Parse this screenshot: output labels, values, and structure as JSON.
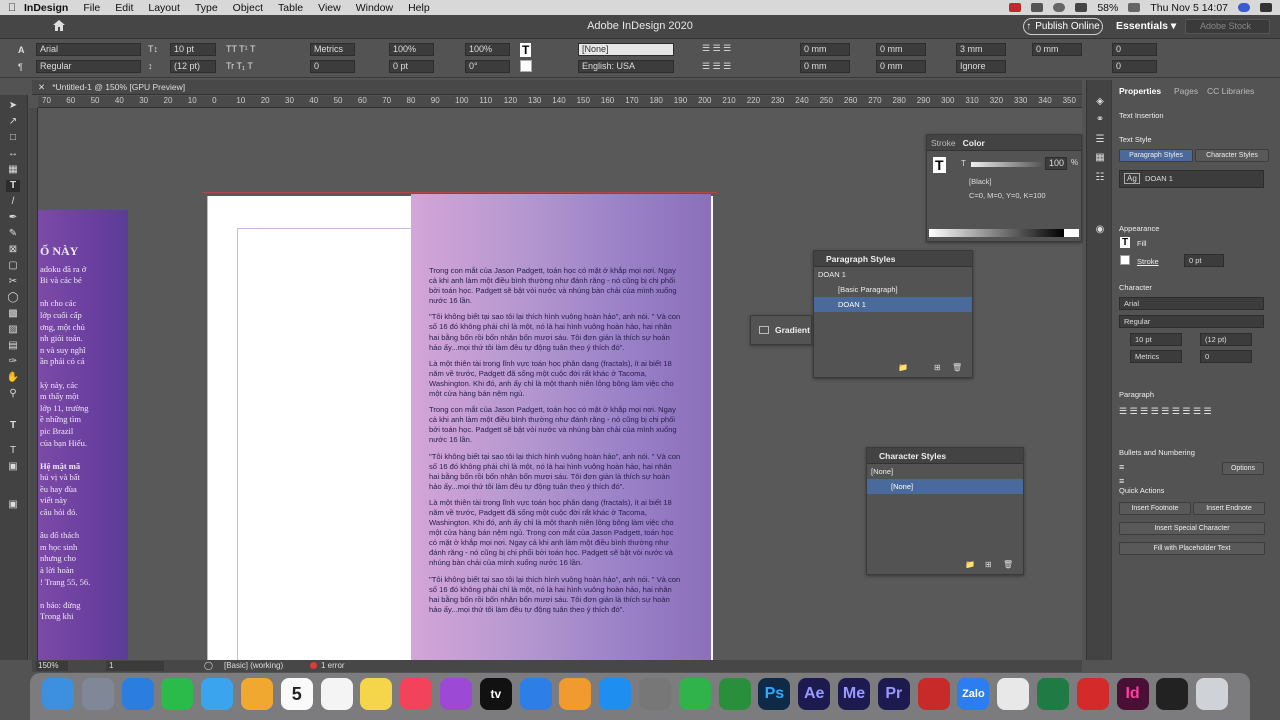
{
  "menubar": {
    "app": "InDesign",
    "items": [
      "File",
      "Edit",
      "Layout",
      "Type",
      "Object",
      "Table",
      "View",
      "Window",
      "Help"
    ],
    "battery": "58%",
    "datetime": "Thu Nov 5  14:07"
  },
  "appbar": {
    "title": "Adobe InDesign 2020",
    "publish": "Publish Online",
    "workspace": "Essentials",
    "search_placeholder": "Adobe Stock"
  },
  "control": {
    "font": "Arial",
    "style": "Regular",
    "size": "10 pt",
    "leading": "(12 pt)",
    "kerning": "Metrics",
    "tracking": "0",
    "vscale": "100%",
    "hscale": "100%",
    "baseline": "0 pt",
    "skew": "0°",
    "char_style": "[None]",
    "language": "English: USA",
    "left_indent": "0 mm",
    "first_indent": "0 mm",
    "space_before": "0 mm",
    "right_indent": "0 mm",
    "last_indent": "0 mm",
    "space_after": "0 mm",
    "col": "0",
    "col2": "0",
    "dropcap": "3 mm",
    "ignore": "Ignore"
  },
  "document": {
    "tab": "*Untitled-1 @ 150% [GPU Preview]",
    "ruler_marks": [
      "70",
      "60",
      "50",
      "40",
      "30",
      "20",
      "10",
      "0",
      "10",
      "20",
      "30",
      "40",
      "50",
      "60",
      "70",
      "80",
      "90",
      "100",
      "110",
      "120",
      "130",
      "140",
      "150",
      "160",
      "170",
      "180",
      "190",
      "200",
      "210",
      "220",
      "230",
      "240",
      "250",
      "260",
      "270",
      "280",
      "290",
      "300",
      "310",
      "320",
      "330",
      "340",
      "350"
    ]
  },
  "left_page_text": [
    "Ố NÀY",
    "adoku đã ra ở",
    "Bi và các bé",
    "",
    "nh cho các",
    "lớp cuối cấp",
    "ơng, một chủ",
    "nh giỏi toán.",
    "n và suy nghĩ",
    "ần phải có cả",
    "",
    "kỳ này, các",
    "m thấy một",
    "lớp 11, trường",
    "ề những tìm",
    "pic Brazil",
    "của bạn Hiếu.",
    "",
    "Hệ mật mã",
    "hú vị và bất",
    "ều hay đùa",
    "viết này",
    "câu hỏi đó.",
    "",
    "âu đố thách",
    "m học sinh",
    "nhưng cho",
    "à lời hoàn",
    "! Trang 55, 56.",
    "",
    "n báo: đừng",
    "Trong khi"
  ],
  "text_frame": [
    "Trong con mắt của Jason Padgett, toán học có mặt ở khắp mọi nơi. Ngay cả khi anh làm một điều bình thường như đánh răng - nó cũng bị chi phối bởi toán học. Padgett sẽ bật vòi nước và nhúng bàn chải của mình xuống nước 16 lần.",
    "\"Tôi không biết tại sao tôi lại thích hình vuông hoàn hảo\", anh nói. \" Và con số 16 đó không phải chỉ là một, nó là hai hình vuông hoàn hảo, hai nhân hai bằng bốn rồi bốn nhân bốn mươi sáu. Tôi đơn giản là thích sự hoàn hảo ấy...mọi thứ tôi làm đều tự động tuân theo ý thích đó\".",
    "Là một thiên tài trong lĩnh vực toán học phân dạng (fractals), ít ai biết 18 năm về trước, Padgett đã sống một cuộc đời rất khác ở Tacoma, Washington. Khi đó, anh ấy chỉ là một thanh niên lông bông làm việc cho một cửa hàng bán nệm ngủ.",
    "Trong con mắt của Jason Padgett, toán học có mặt ở khắp mọi nơi. Ngay cả khi anh làm một điều bình thường như đánh răng - nó cũng bị chi phối bởi toán học. Padgett sẽ bật vòi nước và nhúng bàn chải của mình xuống nước 16 lần.",
    "\"Tôi không biết tại sao tôi lại thích hình vuông hoàn hảo\", anh nói. \" Và con số 16 đó không phải chỉ là một, nó là hai hình vuông hoàn hảo, hai nhân hai bằng bốn rồi bốn nhân bốn mươi sáu. Tôi đơn giản là thích sự hoàn hảo ấy...mọi thứ tôi làm đều tự động tuân theo ý thích đó\".",
    "Là một thiên tài trong lĩnh vực toán học phân dạng (fractals), ít ai biết 18 năm về trước, Padgett đã sống một cuộc đời rất khác ở Tacoma, Washington. Khi đó, anh ấy chỉ là một thanh niên lông bông làm việc cho một cửa hàng bán nệm ngủ. Trong con mắt của Jason Padgett, toán học có mặt ở khắp mọi nơi. Ngay cả khi anh làm một điều bình thường như đánh răng - nó cũng bị chi phối bởi toán học. Padgett sẽ bật vòi nước và nhúng bàn chải của mình xuống nước 16 lần.",
    "\"Tôi không biết tại sao tôi lại thích hình vuông hoàn hảo\", anh nói. \" Và con số 16 đó không phải chỉ là một, nó là hai hình vuông hoàn hảo, hai nhân hai bằng bốn rồi bốn nhân bốn mươi sáu. Tôi đơn giản là thích sự hoàn hảo ấy...mọi thứ tôi làm đều tự động tuân theo ý thích đó\"."
  ],
  "status": {
    "zoom": "150%",
    "page": "1",
    "preflight_profile": "[Basic] (working)",
    "errors": "1 error"
  },
  "color_panel": {
    "tab1": "Stroke",
    "tab2": "Color",
    "tint": "100",
    "percent": "%",
    "swatch": "[Black]",
    "values": "C=0, M=0, Y=0, K=100"
  },
  "paragraph_styles": {
    "title": "Paragraph Styles",
    "current": "DOAN 1",
    "items": [
      "[Basic Paragraph]",
      "DOAN 1"
    ]
  },
  "gradient_panel": {
    "title": "Gradient"
  },
  "character_styles": {
    "title": "Character Styles",
    "current": "[None]",
    "items": [
      "[None]"
    ]
  },
  "properties": {
    "tabs": [
      "Properties",
      "Pages",
      "CC Libraries"
    ],
    "text_insertion": "Text Insertion",
    "text_style": "Text Style",
    "style_tabs": [
      "Paragraph Styles",
      "Character Styles"
    ],
    "para_style": "DOAN 1",
    "appearance": "Appearance",
    "fill": "Fill",
    "stroke": "Stroke",
    "stroke_weight": "0 pt",
    "character": "Character",
    "font": "Arial",
    "style": "Regular",
    "size": "10 pt",
    "leading": "(12 pt)",
    "kerning": "Metrics",
    "tracking": "0",
    "paragraph": "Paragraph",
    "bullets": "Bullets and Numbering",
    "options": "Options",
    "quick_actions": "Quick Actions",
    "insert_footnote": "Insert Footnote",
    "insert_endnote": "Insert Endnote",
    "insert_special": "Insert Special Character",
    "fill_placeholder": "Fill with Placeholder Text"
  },
  "dock": [
    "Finder",
    "Launchpad",
    "Safari",
    "FaceTime",
    "Messages",
    "Photos",
    "Calendar",
    "Reminders",
    "Notes",
    "Music",
    "Podcasts",
    "TV",
    "Keynote",
    "Pages",
    "App Store",
    "System Preferences",
    "Numbers",
    "Numbers2",
    "Ps",
    "Ae",
    "Me",
    "Pr",
    "Acrobat",
    "Zalo",
    "Chrome",
    "Excel",
    "Acrobat Reader",
    "Id",
    "Terminal",
    "Trash"
  ],
  "dock_labels": {
    "ps": "Ps",
    "ae": "Ae",
    "me": "Me",
    "pr": "Pr",
    "id": "Id",
    "zalo": "Zalo",
    "calendar_day": "5",
    "calendar_month": "NOV",
    "tv": "tv"
  }
}
